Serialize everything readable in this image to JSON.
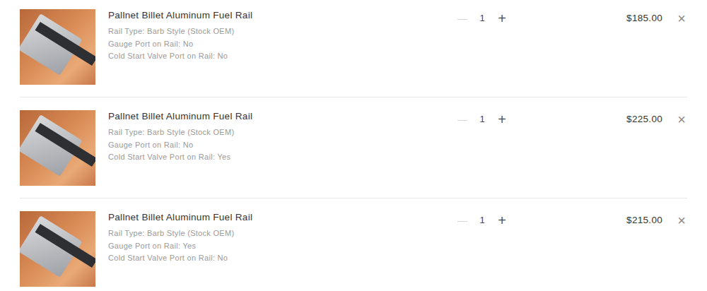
{
  "cart": {
    "items": [
      {
        "title": "Pallnet Billet Aluminum Fuel Rail",
        "options": [
          "Rail Type: Barb Style (Stock OEM)",
          "Gauge Port on Rail: No",
          "Cold Start Valve Port on Rail: No"
        ],
        "decrement": "—",
        "decrement_disabled": true,
        "quantity": "1",
        "increment": "+",
        "price": "$185.00",
        "remove": "×"
      },
      {
        "title": "Pallnet Billet Aluminum Fuel Rail",
        "options": [
          "Rail Type: Barb Style (Stock OEM)",
          "Gauge Port on Rail: No",
          "Cold Start Valve Port on Rail: Yes"
        ],
        "decrement": "—",
        "decrement_disabled": true,
        "quantity": "1",
        "increment": "+",
        "price": "$225.00",
        "remove": "×"
      },
      {
        "title": "Pallnet Billet Aluminum Fuel Rail",
        "options": [
          "Rail Type: Barb Style (Stock OEM)",
          "Gauge Port on Rail: Yes",
          "Cold Start Valve Port on Rail: No"
        ],
        "decrement": "—",
        "decrement_disabled": true,
        "quantity": "1",
        "increment": "+",
        "price": "$215.00",
        "remove": "×"
      }
    ]
  }
}
